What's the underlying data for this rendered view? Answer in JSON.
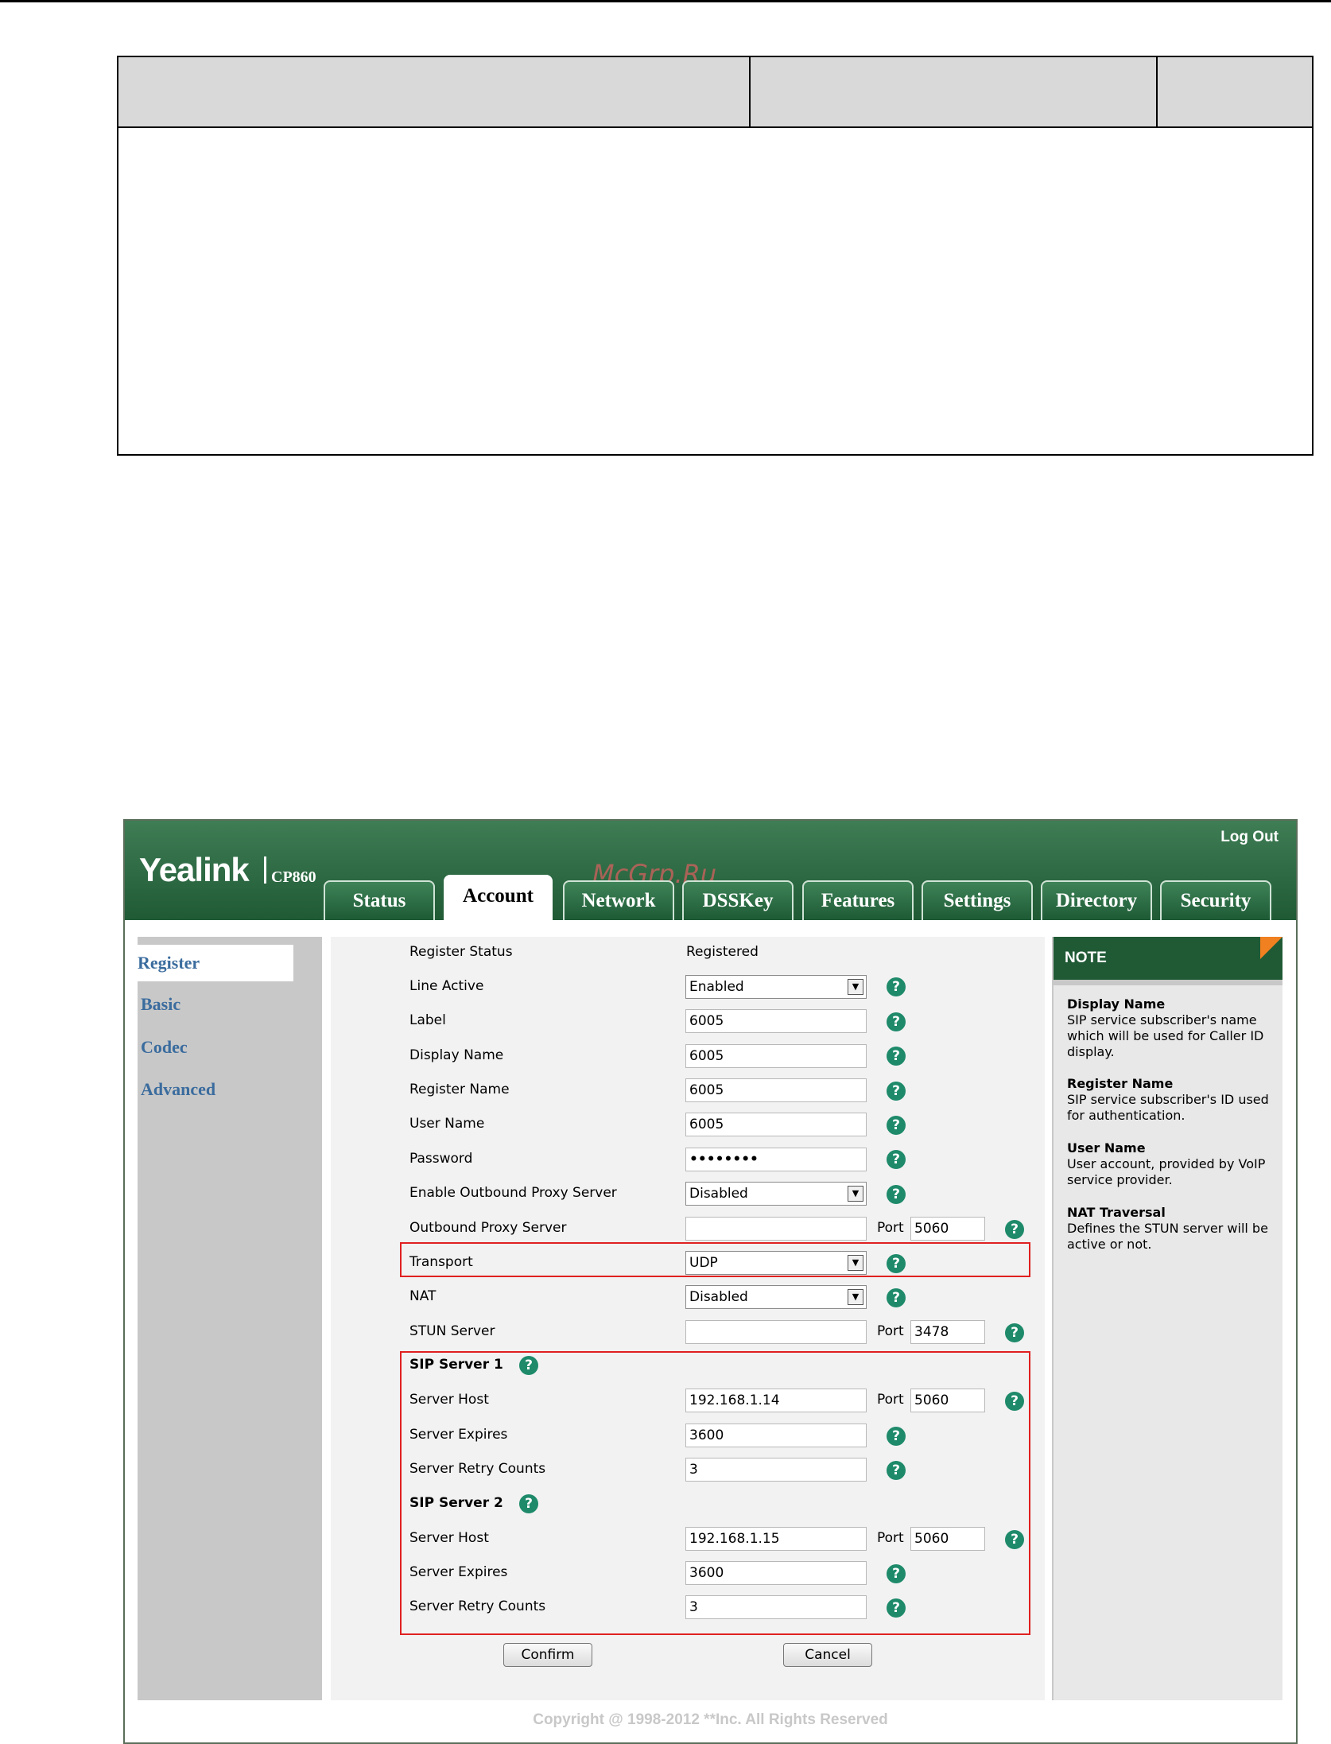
{
  "brand": {
    "logo": "Yealink",
    "model": "CP860",
    "watermark": "McGrp.Ru",
    "logout": "Log Out"
  },
  "tabs": [
    "Status",
    "Account",
    "Network",
    "DSSKey",
    "Features",
    "Settings",
    "Directory",
    "Security"
  ],
  "active_tab": "Account",
  "sidebar": {
    "items": [
      "Register",
      "Basic",
      "Codec",
      "Advanced"
    ],
    "active": "Register"
  },
  "form": {
    "register_status_label": "Register Status",
    "register_status_value": "Registered",
    "line_active_label": "Line Active",
    "line_active_value": "Enabled",
    "label_label": "Label",
    "label_value": "6005",
    "display_name_label": "Display Name",
    "display_name_value": "6005",
    "register_name_label": "Register Name",
    "register_name_value": "6005",
    "user_name_label": "User Name",
    "user_name_value": "6005",
    "password_label": "Password",
    "password_value": "••••••••",
    "outbound_enable_label": "Enable Outbound Proxy Server",
    "outbound_enable_value": "Disabled",
    "outbound_server_label": "Outbound Proxy Server",
    "outbound_server_value": "",
    "outbound_port": "5060",
    "transport_label": "Transport",
    "transport_value": "UDP",
    "nat_label": "NAT",
    "nat_value": "Disabled",
    "stun_label": "STUN Server",
    "stun_value": "",
    "stun_port": "3478",
    "port_label": "Port",
    "sip1": {
      "title": "SIP Server 1",
      "host_label": "Server Host",
      "host": "192.168.1.14",
      "port": "5060",
      "expires_label": "Server Expires",
      "expires": "3600",
      "retry_label": "Server Retry Counts",
      "retry": "3"
    },
    "sip2": {
      "title": "SIP Server 2",
      "host_label": "Server Host",
      "host": "192.168.1.15",
      "port": "5060",
      "expires_label": "Server Expires",
      "expires": "3600",
      "retry_label": "Server Retry Counts",
      "retry": "3"
    },
    "confirm": "Confirm",
    "cancel": "Cancel"
  },
  "note": {
    "title": "NOTE",
    "items": [
      {
        "title": "Display Name",
        "text": "SIP service subscriber's name which will be used for Caller ID display."
      },
      {
        "title": "Register Name",
        "text": "SIP service subscriber's ID used for authentication."
      },
      {
        "title": "User Name",
        "text": "User account, provided by VoIP service provider."
      },
      {
        "title": "NAT Traversal",
        "text": "Defines the STUN server will be active or not."
      }
    ]
  },
  "copyright": "Copyright @ 1998-2012 **Inc. All Rights Reserved",
  "colors": {
    "header_green": "#1f5a35",
    "link_blue": "#3b6c9e",
    "highlight_red": "#e02020",
    "help_green": "#1e8a6a"
  }
}
